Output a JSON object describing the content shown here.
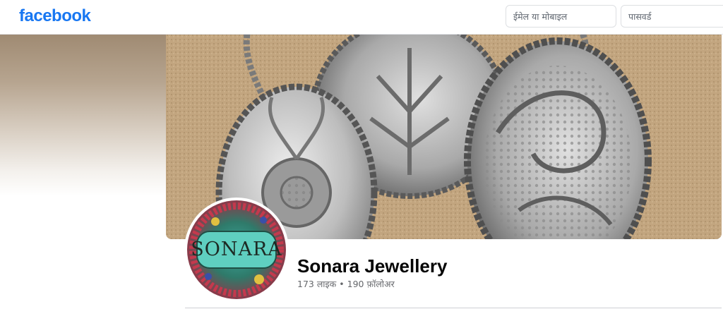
{
  "header": {
    "logo_text": "facebook",
    "email_placeholder": "ईमेल या मोबाइल",
    "password_placeholder": "पासवर्ड"
  },
  "page": {
    "name": "Sonara Jewellery",
    "avatar_text": "SONARA",
    "likes": "173 लाइक",
    "separator": " • ",
    "followers": "190 फ़ॉलोअर"
  },
  "colors": {
    "brand": "#1877f2",
    "text_primary": "#050505",
    "text_secondary": "#65676b"
  }
}
